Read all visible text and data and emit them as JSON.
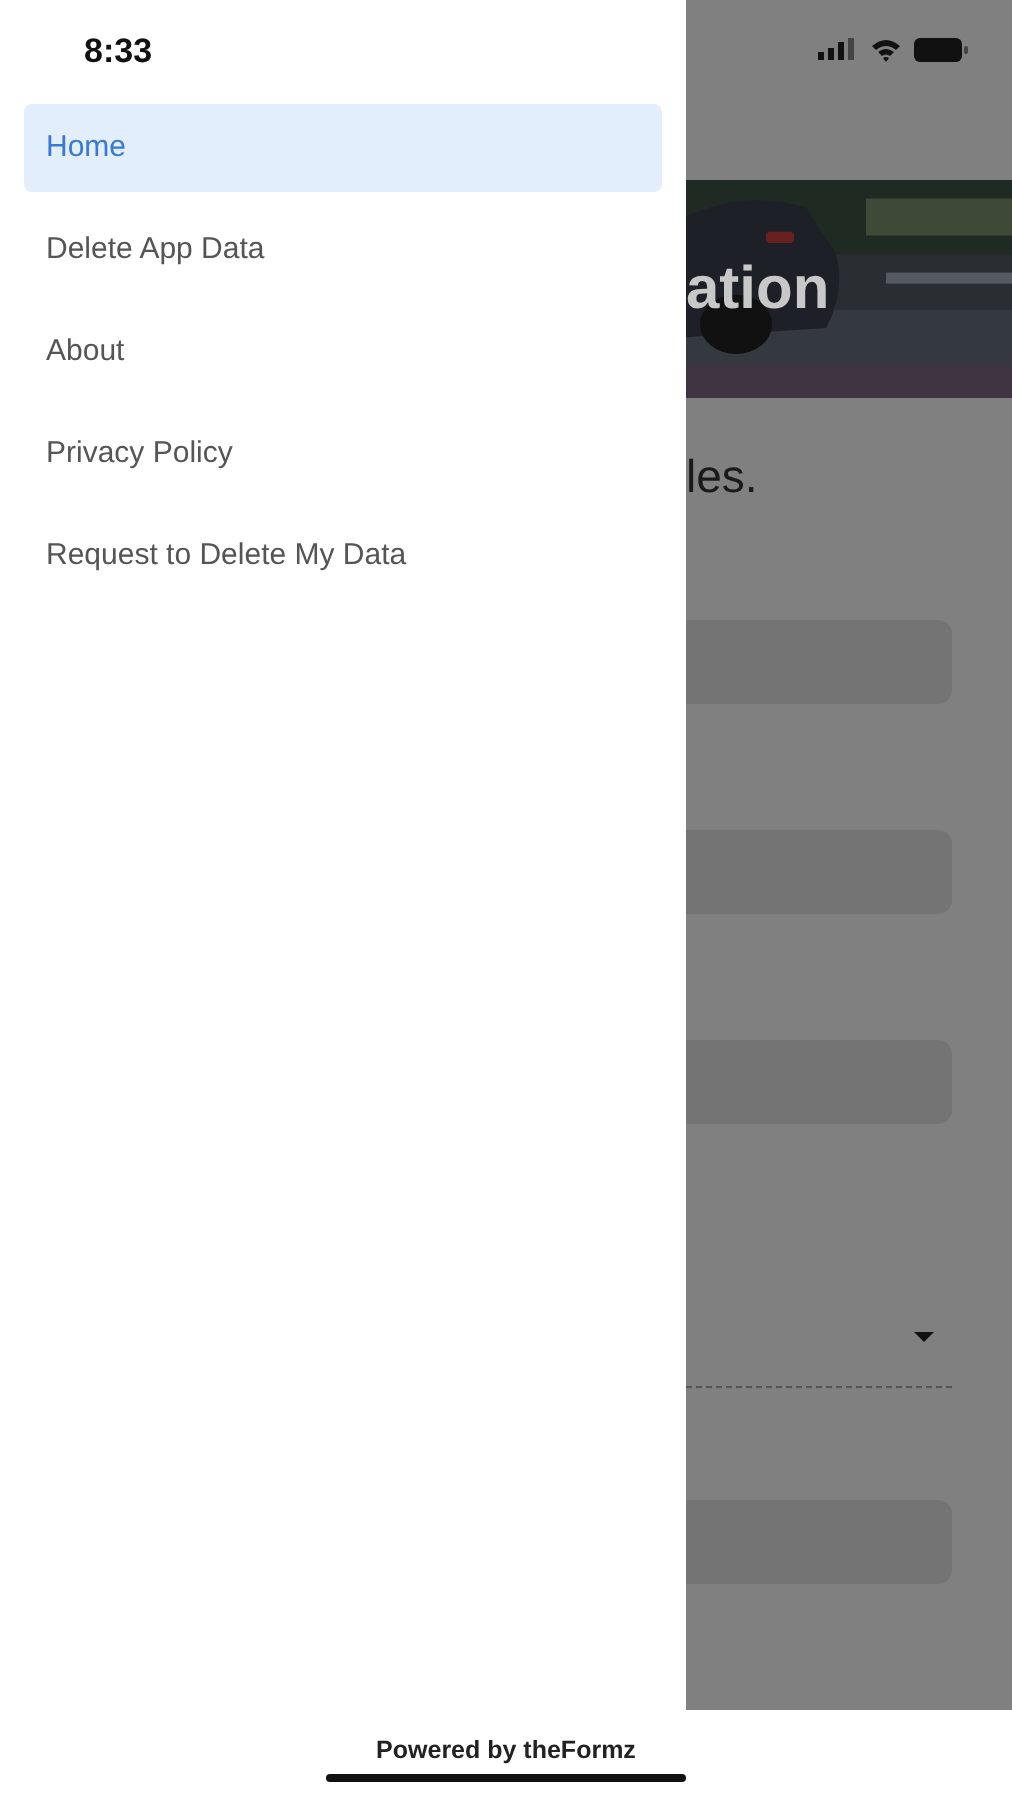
{
  "status_bar": {
    "time": "8:33"
  },
  "drawer": {
    "items": [
      {
        "label": "Home",
        "selected": true
      },
      {
        "label": "Delete App Data",
        "selected": false
      },
      {
        "label": "About",
        "selected": false
      },
      {
        "label": "Privacy Policy",
        "selected": false
      },
      {
        "label": "Request to Delete My Data",
        "selected": false
      }
    ]
  },
  "background_screen": {
    "banner": {
      "kind": "picture",
      "title": "ation"
    },
    "subtitle": "les.",
    "fields": [
      {
        "kind": "text"
      },
      {
        "kind": "text"
      },
      {
        "kind": "text"
      },
      {
        "kind": "dropdown"
      },
      {
        "kind": "text"
      }
    ]
  },
  "footer": {
    "text": "Powered by theFormz"
  }
}
